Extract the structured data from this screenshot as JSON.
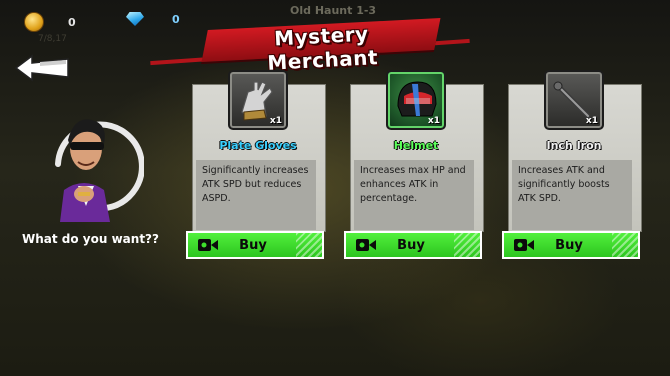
{
  "hud": {
    "coins": "0",
    "gems": "0",
    "location": "Old Haunt 1-3",
    "sub_label": "7/8,17"
  },
  "title": "Mystery Merchant",
  "merchant": {
    "question": "What do you want??"
  },
  "items": [
    {
      "name": "Plate Gloves",
      "name_color": "#3ad0ff",
      "quantity": "x1",
      "icon": "gauntlet-icon",
      "description": "Significantly increases ATK SPD but reduces ASPD.",
      "buy_label": "Buy"
    },
    {
      "name": "Helmet",
      "name_color": "#5cff5a",
      "quantity": "x1",
      "icon": "helmet-icon",
      "description": "Increases max HP and enhances ATK in percentage.",
      "buy_label": "Buy"
    },
    {
      "name": "Inch Iron",
      "name_color": "#f2f2f2",
      "quantity": "x1",
      "icon": "iron-rod-icon",
      "description": "Increases ATK and significantly boosts ATK SPD.",
      "buy_label": "Buy"
    }
  ],
  "colors": {
    "banner": "#c8151c",
    "buy_button": "#3ee02c",
    "card": "#d0d0ca"
  }
}
